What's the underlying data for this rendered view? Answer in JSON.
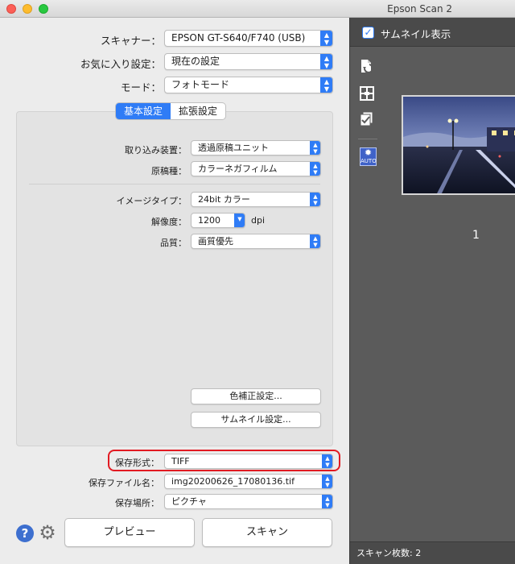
{
  "window": {
    "title": "Epson Scan 2"
  },
  "top": {
    "scanner": {
      "label": "スキャナー：",
      "value": "EPSON GT-S640/F740 (USB)"
    },
    "favorite": {
      "label": "お気に入り設定：",
      "value": "現在の設定"
    },
    "mode": {
      "label": "モード：",
      "value": "フォトモード"
    }
  },
  "tabs": {
    "basic": "基本設定",
    "advanced": "拡張設定"
  },
  "basic": {
    "source": {
      "label": "取り込み装置：",
      "value": "透過原稿ユニット"
    },
    "doc_type": {
      "label": "原稿種：",
      "value": "カラーネガフィルム"
    },
    "image_type": {
      "label": "イメージタイプ：",
      "value": "24bit カラー"
    },
    "resolution": {
      "label": "解像度：",
      "value": "1200",
      "unit": "dpi"
    },
    "quality": {
      "label": "品質：",
      "value": "画質優先"
    },
    "color_correction_button": "色補正設定...",
    "thumbnail_button": "サムネイル設定..."
  },
  "save": {
    "format": {
      "label": "保存形式：",
      "value": "TIFF"
    },
    "filename": {
      "label": "保存ファイル名：",
      "value": "img20200626_17080136.tif"
    },
    "location": {
      "label": "保存場所：",
      "value": "ピクチャ"
    }
  },
  "actions": {
    "preview": "プレビュー",
    "scan": "スキャン",
    "help": "?"
  },
  "preview_panel": {
    "thumbnail_toggle": {
      "label": "サムネイル表示",
      "checked": true
    },
    "thumbnail_number": "1",
    "auto_label": "AUTO",
    "status": "スキャン枚数: 2"
  },
  "colors": {
    "accent": "#2f7cf6",
    "highlight": "#e21a22",
    "panel": "#5b5b5b"
  }
}
